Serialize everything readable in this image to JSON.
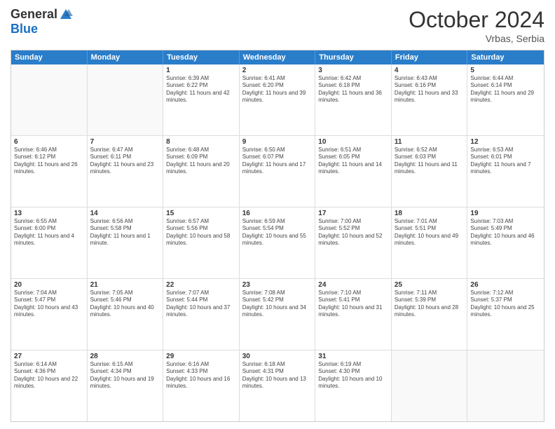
{
  "header": {
    "logo": {
      "general": "General",
      "blue": "Blue"
    },
    "title": "October 2024",
    "subtitle": "Vrbas, Serbia"
  },
  "weekdays": [
    "Sunday",
    "Monday",
    "Tuesday",
    "Wednesday",
    "Thursday",
    "Friday",
    "Saturday"
  ],
  "rows": [
    [
      {
        "day": "",
        "empty": true
      },
      {
        "day": "",
        "empty": true
      },
      {
        "day": "1",
        "sunrise": "Sunrise: 6:39 AM",
        "sunset": "Sunset: 6:22 PM",
        "daylight": "Daylight: 11 hours and 42 minutes."
      },
      {
        "day": "2",
        "sunrise": "Sunrise: 6:41 AM",
        "sunset": "Sunset: 6:20 PM",
        "daylight": "Daylight: 11 hours and 39 minutes."
      },
      {
        "day": "3",
        "sunrise": "Sunrise: 6:42 AM",
        "sunset": "Sunset: 6:18 PM",
        "daylight": "Daylight: 11 hours and 36 minutes."
      },
      {
        "day": "4",
        "sunrise": "Sunrise: 6:43 AM",
        "sunset": "Sunset: 6:16 PM",
        "daylight": "Daylight: 11 hours and 33 minutes."
      },
      {
        "day": "5",
        "sunrise": "Sunrise: 6:44 AM",
        "sunset": "Sunset: 6:14 PM",
        "daylight": "Daylight: 11 hours and 29 minutes."
      }
    ],
    [
      {
        "day": "6",
        "sunrise": "Sunrise: 6:46 AM",
        "sunset": "Sunset: 6:12 PM",
        "daylight": "Daylight: 11 hours and 26 minutes."
      },
      {
        "day": "7",
        "sunrise": "Sunrise: 6:47 AM",
        "sunset": "Sunset: 6:11 PM",
        "daylight": "Daylight: 11 hours and 23 minutes."
      },
      {
        "day": "8",
        "sunrise": "Sunrise: 6:48 AM",
        "sunset": "Sunset: 6:09 PM",
        "daylight": "Daylight: 11 hours and 20 minutes."
      },
      {
        "day": "9",
        "sunrise": "Sunrise: 6:50 AM",
        "sunset": "Sunset: 6:07 PM",
        "daylight": "Daylight: 11 hours and 17 minutes."
      },
      {
        "day": "10",
        "sunrise": "Sunrise: 6:51 AM",
        "sunset": "Sunset: 6:05 PM",
        "daylight": "Daylight: 11 hours and 14 minutes."
      },
      {
        "day": "11",
        "sunrise": "Sunrise: 6:52 AM",
        "sunset": "Sunset: 6:03 PM",
        "daylight": "Daylight: 11 hours and 11 minutes."
      },
      {
        "day": "12",
        "sunrise": "Sunrise: 6:53 AM",
        "sunset": "Sunset: 6:01 PM",
        "daylight": "Daylight: 11 hours and 7 minutes."
      }
    ],
    [
      {
        "day": "13",
        "sunrise": "Sunrise: 6:55 AM",
        "sunset": "Sunset: 6:00 PM",
        "daylight": "Daylight: 11 hours and 4 minutes."
      },
      {
        "day": "14",
        "sunrise": "Sunrise: 6:56 AM",
        "sunset": "Sunset: 5:58 PM",
        "daylight": "Daylight: 11 hours and 1 minute."
      },
      {
        "day": "15",
        "sunrise": "Sunrise: 6:57 AM",
        "sunset": "Sunset: 5:56 PM",
        "daylight": "Daylight: 10 hours and 58 minutes."
      },
      {
        "day": "16",
        "sunrise": "Sunrise: 6:59 AM",
        "sunset": "Sunset: 5:54 PM",
        "daylight": "Daylight: 10 hours and 55 minutes."
      },
      {
        "day": "17",
        "sunrise": "Sunrise: 7:00 AM",
        "sunset": "Sunset: 5:52 PM",
        "daylight": "Daylight: 10 hours and 52 minutes."
      },
      {
        "day": "18",
        "sunrise": "Sunrise: 7:01 AM",
        "sunset": "Sunset: 5:51 PM",
        "daylight": "Daylight: 10 hours and 49 minutes."
      },
      {
        "day": "19",
        "sunrise": "Sunrise: 7:03 AM",
        "sunset": "Sunset: 5:49 PM",
        "daylight": "Daylight: 10 hours and 46 minutes."
      }
    ],
    [
      {
        "day": "20",
        "sunrise": "Sunrise: 7:04 AM",
        "sunset": "Sunset: 5:47 PM",
        "daylight": "Daylight: 10 hours and 43 minutes."
      },
      {
        "day": "21",
        "sunrise": "Sunrise: 7:05 AM",
        "sunset": "Sunset: 5:46 PM",
        "daylight": "Daylight: 10 hours and 40 minutes."
      },
      {
        "day": "22",
        "sunrise": "Sunrise: 7:07 AM",
        "sunset": "Sunset: 5:44 PM",
        "daylight": "Daylight: 10 hours and 37 minutes."
      },
      {
        "day": "23",
        "sunrise": "Sunrise: 7:08 AM",
        "sunset": "Sunset: 5:42 PM",
        "daylight": "Daylight: 10 hours and 34 minutes."
      },
      {
        "day": "24",
        "sunrise": "Sunrise: 7:10 AM",
        "sunset": "Sunset: 5:41 PM",
        "daylight": "Daylight: 10 hours and 31 minutes."
      },
      {
        "day": "25",
        "sunrise": "Sunrise: 7:11 AM",
        "sunset": "Sunset: 5:39 PM",
        "daylight": "Daylight: 10 hours and 28 minutes."
      },
      {
        "day": "26",
        "sunrise": "Sunrise: 7:12 AM",
        "sunset": "Sunset: 5:37 PM",
        "daylight": "Daylight: 10 hours and 25 minutes."
      }
    ],
    [
      {
        "day": "27",
        "sunrise": "Sunrise: 6:14 AM",
        "sunset": "Sunset: 4:36 PM",
        "daylight": "Daylight: 10 hours and 22 minutes."
      },
      {
        "day": "28",
        "sunrise": "Sunrise: 6:15 AM",
        "sunset": "Sunset: 4:34 PM",
        "daylight": "Daylight: 10 hours and 19 minutes."
      },
      {
        "day": "29",
        "sunrise": "Sunrise: 6:16 AM",
        "sunset": "Sunset: 4:33 PM",
        "daylight": "Daylight: 10 hours and 16 minutes."
      },
      {
        "day": "30",
        "sunrise": "Sunrise: 6:18 AM",
        "sunset": "Sunset: 4:31 PM",
        "daylight": "Daylight: 10 hours and 13 minutes."
      },
      {
        "day": "31",
        "sunrise": "Sunrise: 6:19 AM",
        "sunset": "Sunset: 4:30 PM",
        "daylight": "Daylight: 10 hours and 10 minutes."
      },
      {
        "day": "",
        "empty": true
      },
      {
        "day": "",
        "empty": true
      }
    ]
  ]
}
